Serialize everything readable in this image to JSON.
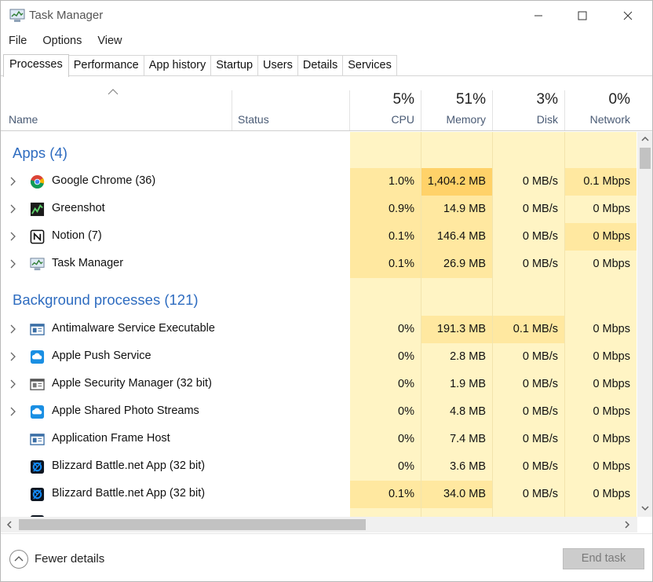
{
  "window": {
    "title": "Task Manager"
  },
  "menu": [
    "File",
    "Options",
    "View"
  ],
  "tabs": [
    "Processes",
    "Performance",
    "App history",
    "Startup",
    "Users",
    "Details",
    "Services"
  ],
  "header": {
    "name": "Name",
    "status": "Status",
    "cpu_pct": "5%",
    "cpu": "CPU",
    "memory_pct": "51%",
    "memory": "Memory",
    "disk_pct": "3%",
    "disk": "Disk",
    "network_pct": "0%",
    "network": "Network"
  },
  "groups": {
    "apps": "Apps (4)",
    "background": "Background processes (121)"
  },
  "apps": [
    {
      "name": "Google Chrome (36)",
      "cpu": "1.0%",
      "memory": "1,404.2 MB",
      "disk": "0 MB/s",
      "network": "0.1 Mbps",
      "icon": "chrome-icon"
    },
    {
      "name": "Greenshot",
      "cpu": "0.9%",
      "memory": "14.9 MB",
      "disk": "0 MB/s",
      "network": "0 Mbps",
      "icon": "greenshot-icon"
    },
    {
      "name": "Notion (7)",
      "cpu": "0.1%",
      "memory": "146.4 MB",
      "disk": "0 MB/s",
      "network": "0 Mbps",
      "icon": "notion-icon"
    },
    {
      "name": "Task Manager",
      "cpu": "0.1%",
      "memory": "26.9 MB",
      "disk": "0 MB/s",
      "network": "0 Mbps",
      "icon": "task-manager-icon"
    }
  ],
  "background": [
    {
      "name": "Antimalware Service Executable",
      "cpu": "0%",
      "memory": "191.3 MB",
      "disk": "0.1 MB/s",
      "network": "0 Mbps",
      "icon": "window-app-icon"
    },
    {
      "name": "Apple Push Service",
      "cpu": "0%",
      "memory": "2.8 MB",
      "disk": "0 MB/s",
      "network": "0 Mbps",
      "icon": "apple-service-icon"
    },
    {
      "name": "Apple Security Manager (32 bit)",
      "cpu": "0%",
      "memory": "1.9 MB",
      "disk": "0 MB/s",
      "network": "0 Mbps",
      "icon": "window-app-icon"
    },
    {
      "name": "Apple Shared Photo Streams",
      "cpu": "0%",
      "memory": "4.8 MB",
      "disk": "0 MB/s",
      "network": "0 Mbps",
      "icon": "apple-service-icon"
    },
    {
      "name": "Application Frame Host",
      "cpu": "0%",
      "memory": "7.4 MB",
      "disk": "0 MB/s",
      "network": "0 Mbps",
      "icon": "window-app-icon"
    },
    {
      "name": "Blizzard Battle.net App (32 bit)",
      "cpu": "0%",
      "memory": "3.6 MB",
      "disk": "0 MB/s",
      "network": "0 Mbps",
      "icon": "battlenet-icon"
    },
    {
      "name": "Blizzard Battle.net App (32 bit)",
      "cpu": "0.1%",
      "memory": "34.0 MB",
      "disk": "0 MB/s",
      "network": "0 Mbps",
      "icon": "battlenet-icon"
    }
  ],
  "footer": {
    "fewer_details": "Fewer details",
    "end_task": "End task"
  },
  "colors": {
    "accent": "#2e6cc0",
    "heat_low": "#fff4c4",
    "heat_mid": "#ffe8a0",
    "heat_high": "#ffd269"
  }
}
